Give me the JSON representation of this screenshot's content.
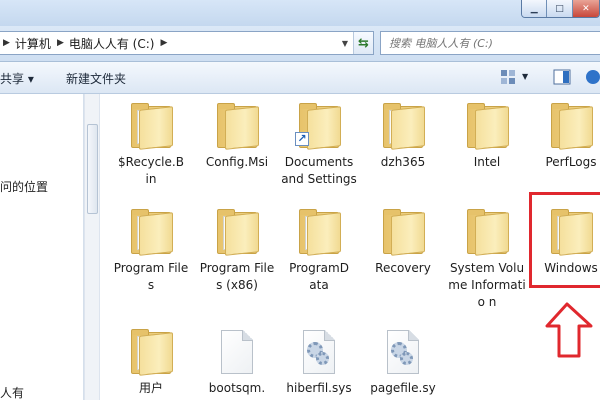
{
  "window": {
    "minimize_glyph": "▁",
    "maximize_glyph": "□",
    "close_glyph": "✕"
  },
  "address": {
    "breadcrumbs": [
      "计算机",
      "电脑人人有 (C:)"
    ],
    "search_placeholder": "搜索 电脑人人有 (C:)"
  },
  "toolbar": {
    "share_label": "共享 ▾",
    "newfolder_label": "新建文件夹"
  },
  "navpane": {
    "items": [
      "问的位置",
      "人有"
    ]
  },
  "items": [
    {
      "name": "$Recycle.Bin",
      "label": "$Recycle.B\nin",
      "kind": "folder"
    },
    {
      "name": "Config.Msi",
      "label": "Config.Msi",
      "kind": "folder"
    },
    {
      "name": "Documents and Settings",
      "label": "Documents and Settings",
      "kind": "folder-shortcut"
    },
    {
      "name": "dzh365",
      "label": "dzh365",
      "kind": "folder"
    },
    {
      "name": "Intel",
      "label": "Intel",
      "kind": "folder"
    },
    {
      "name": "PerfLogs",
      "label": "PerfLogs",
      "kind": "folder"
    },
    {
      "name": "Program Files",
      "label": "Program Files",
      "kind": "folder"
    },
    {
      "name": "Program Files (x86)",
      "label": "Program Files (x86)",
      "kind": "folder"
    },
    {
      "name": "ProgramData",
      "label": "ProgramD\nata",
      "kind": "folder"
    },
    {
      "name": "Recovery",
      "label": "Recovery",
      "kind": "folder"
    },
    {
      "name": "System Volume Information",
      "label": "System Volume Informatio n",
      "kind": "folder"
    },
    {
      "name": "Windows",
      "label": "Windows",
      "kind": "folder"
    },
    {
      "name": "用户",
      "label": "用户",
      "kind": "folder"
    },
    {
      "name": "bootsqm.",
      "label": "bootsqm.",
      "kind": "file"
    },
    {
      "name": "hiberfil.sys",
      "label": "hiberfil.sys",
      "kind": "sysfile"
    },
    {
      "name": "pagefile.sy",
      "label": "pagefile.sy",
      "kind": "sysfile"
    }
  ],
  "colors": {
    "annotation": "#e0282e",
    "folder": "#f0d78d"
  }
}
